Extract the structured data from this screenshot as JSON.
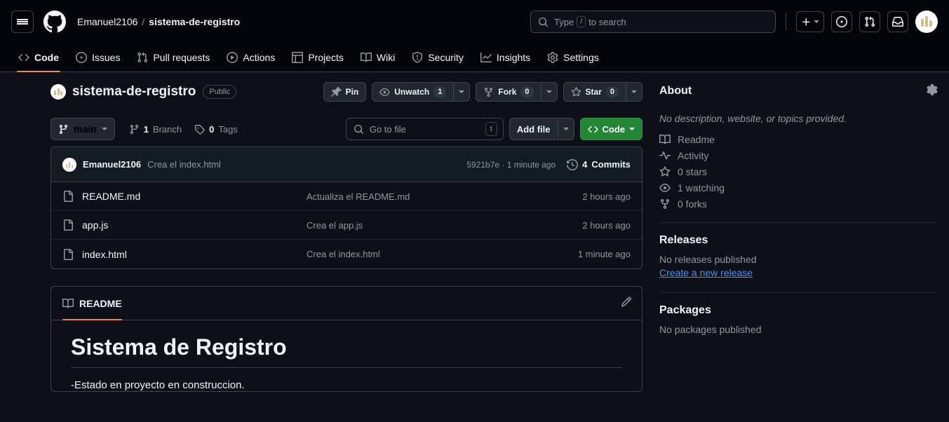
{
  "header": {
    "menu_icon": "hamburger-icon",
    "logo_icon": "github-logo-icon",
    "owner": "Emanuel2106",
    "separator": "/",
    "repo": "sistema-de-registro",
    "search": {
      "placeholder_before": "Type",
      "key": "/",
      "placeholder_after": "to search",
      "icon": "search-icon"
    },
    "create_new_label": "+",
    "icons": [
      "plus-icon",
      "issues-circle-icon",
      "pull-request-icon",
      "inbox-icon",
      "avatar-icon"
    ]
  },
  "repo_nav": [
    {
      "label": "Code",
      "icon": "code-icon",
      "active": true
    },
    {
      "label": "Issues",
      "icon": "issue-opened-icon",
      "active": false
    },
    {
      "label": "Pull requests",
      "icon": "git-pull-request-icon",
      "active": false
    },
    {
      "label": "Actions",
      "icon": "play-icon",
      "active": false
    },
    {
      "label": "Projects",
      "icon": "table-icon",
      "active": false
    },
    {
      "label": "Wiki",
      "icon": "book-icon",
      "active": false
    },
    {
      "label": "Security",
      "icon": "shield-icon",
      "active": false
    },
    {
      "label": "Insights",
      "icon": "graph-icon",
      "active": false
    },
    {
      "label": "Settings",
      "icon": "gear-icon",
      "active": false
    }
  ],
  "repo_title": {
    "name": "sistema-de-registro",
    "visibility": "Public",
    "actions": {
      "pin": "Pin",
      "watch": "Unwatch",
      "watch_count": "1",
      "fork": "Fork",
      "fork_count": "0",
      "star": "Star",
      "star_count": "0"
    }
  },
  "branch_bar": {
    "branch": "main",
    "branch_count": "1",
    "branch_label": "Branch",
    "tag_count": "0",
    "tag_label": "Tags",
    "go_to_file_placeholder": "Go to file",
    "go_to_file_key": "t",
    "add_file": "Add file",
    "code": "Code"
  },
  "commit_bar": {
    "author": "Emanuel2106",
    "message": "Crea el index.html",
    "hash": "5921b7e",
    "relative_time": "1 minute ago",
    "separator": "·",
    "commits_count": "4",
    "commits_label": "Commits"
  },
  "files": [
    {
      "name": "README.md",
      "message": "Actualiza el README.md",
      "time": "2 hours ago",
      "icon": "file-icon"
    },
    {
      "name": "app.js",
      "message": "Crea el app.js",
      "time": "2 hours ago",
      "icon": "file-icon"
    },
    {
      "name": "index.html",
      "message": "Crea el index.html",
      "time": "1 minute ago",
      "icon": "file-icon"
    }
  ],
  "readme": {
    "tab_label": "README",
    "tab_icon": "book-icon",
    "edit_icon": "pencil-icon",
    "heading": "Sistema de Registro",
    "paragraph": "-Estado en proyecto en construccion."
  },
  "sidebar": {
    "about_title": "About",
    "gear_icon": "gear-icon",
    "description": "No description, website, or topics provided.",
    "links": [
      {
        "label": "Readme",
        "icon": "book-icon"
      },
      {
        "label": "Activity",
        "icon": "pulse-icon"
      },
      {
        "label": "0 stars",
        "icon": "star-icon"
      },
      {
        "label": "1 watching",
        "icon": "eye-icon"
      },
      {
        "label": "0 forks",
        "icon": "fork-icon"
      }
    ],
    "releases_title": "Releases",
    "releases_empty": "No releases published",
    "releases_link": "Create a new release",
    "packages_title": "Packages",
    "packages_empty": "No packages published"
  },
  "colors": {
    "page_bg": "#0d1117",
    "header_bg": "#010409",
    "border": "#3d444d",
    "accent_green": "#238636",
    "accent_orange": "#f78166",
    "link_blue": "#4493f8",
    "muted_text": "#9198a1",
    "avatar_gold": "#d4bd8a"
  }
}
